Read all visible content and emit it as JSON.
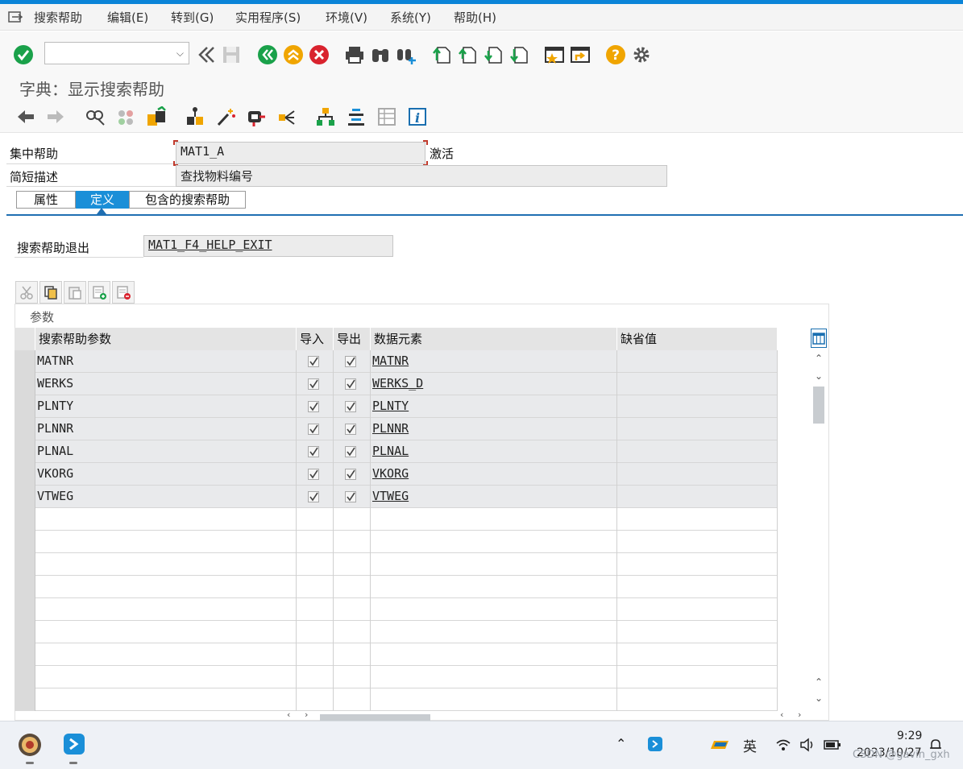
{
  "menu": {
    "items": [
      "搜索帮助",
      "编辑(E)",
      "转到(G)",
      "实用程序(S)",
      "环境(V)",
      "系统(Y)",
      "帮助(H)"
    ]
  },
  "command_field": {
    "value": ""
  },
  "page": {
    "title": "字典：显示搜索帮助"
  },
  "form": {
    "collective_label": "集中帮助",
    "collective_value": "MAT1_A",
    "status": "激活",
    "short_desc_label": "简短描述",
    "short_desc_value": "查找物料编号"
  },
  "tabs": [
    "属性",
    "定义",
    "包含的搜索帮助"
  ],
  "active_tab": "定义",
  "exit": {
    "label": "搜索帮助退出",
    "value": "MAT1_F4_HELP_EXIT"
  },
  "params": {
    "caption": "参数",
    "columns": [
      "搜索帮助参数",
      "导入",
      "导出",
      "数据元素",
      "缺省值"
    ],
    "rows": [
      {
        "param": "MATNR",
        "import": true,
        "export": true,
        "element": "MATNR",
        "default": ""
      },
      {
        "param": "WERKS",
        "import": true,
        "export": true,
        "element": "WERKS_D",
        "default": ""
      },
      {
        "param": "PLNTY",
        "import": true,
        "export": true,
        "element": "PLNTY",
        "default": ""
      },
      {
        "param": "PLNNR",
        "import": true,
        "export": true,
        "element": "PLNNR",
        "default": ""
      },
      {
        "param": "PLNAL",
        "import": true,
        "export": true,
        "element": "PLNAL",
        "default": ""
      },
      {
        "param": "VKORG",
        "import": true,
        "export": true,
        "element": "VKORG",
        "default": ""
      },
      {
        "param": "VTWEG",
        "import": true,
        "export": true,
        "element": "VTWEG",
        "default": ""
      }
    ],
    "empty_rows": 9
  },
  "taskbar": {
    "lang": "英",
    "time": "9:29",
    "date": "2023/10/27",
    "watermark": "CSDN @gavin_gxh"
  },
  "colors": {
    "accent": "#1a8fd8",
    "ok_green": "#1aa14a",
    "cancel_red": "#d9232e",
    "help_orange": "#f0a500"
  }
}
